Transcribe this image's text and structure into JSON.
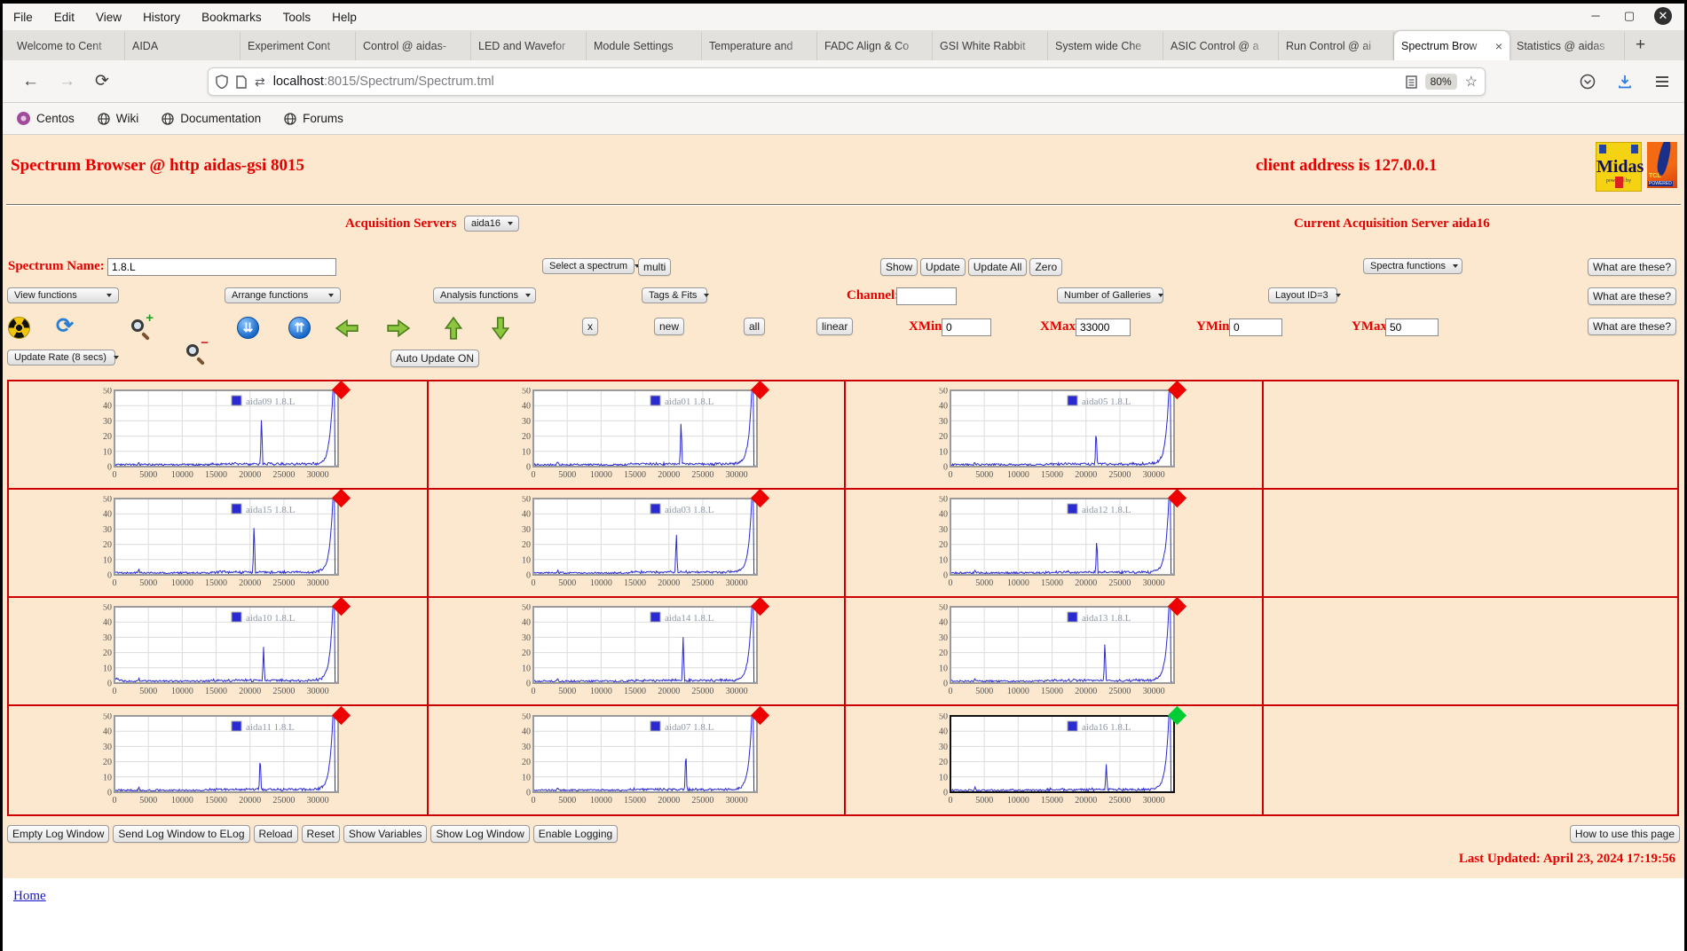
{
  "browser": {
    "menu": [
      "File",
      "Edit",
      "View",
      "History",
      "Bookmarks",
      "Tools",
      "Help"
    ],
    "window_controls": {
      "minimize": "─",
      "maximize": "▢",
      "close": "✕"
    },
    "tabs": [
      {
        "label": "Welcome to Cent",
        "active": false
      },
      {
        "label": "AIDA",
        "active": false
      },
      {
        "label": "Experiment Cont",
        "active": false
      },
      {
        "label": "Control @ aidas-",
        "active": false
      },
      {
        "label": "LED and Wavefor",
        "active": false
      },
      {
        "label": "Module Settings",
        "active": false
      },
      {
        "label": "Temperature and",
        "active": false
      },
      {
        "label": "FADC Align & Co",
        "active": false
      },
      {
        "label": "GSI White Rabbit",
        "active": false
      },
      {
        "label": "System wide Che",
        "active": false
      },
      {
        "label": "ASIC Control @ a",
        "active": false
      },
      {
        "label": "Run Control @ ai",
        "active": false
      },
      {
        "label": "Spectrum Brow",
        "active": true
      },
      {
        "label": "Statistics @ aidas",
        "active": false
      }
    ],
    "new_tab_label": "+",
    "url": {
      "host": "localhost",
      "rest": ":8015/Spectrum/Spectrum.tml"
    },
    "zoom_badge": "80%",
    "bookmarks": [
      {
        "label": "Centos",
        "icon": "centos-icon"
      },
      {
        "label": "Wiki",
        "icon": "globe-icon"
      },
      {
        "label": "Documentation",
        "icon": "globe-icon"
      },
      {
        "label": "Forums",
        "icon": "globe-icon"
      }
    ]
  },
  "page": {
    "title": "Spectrum Browser @ http aidas-gsi 8015",
    "client_address": "client address is 127.0.0.1",
    "acquisition_servers_label": "Acquisition Servers",
    "acquisition_server_selected": "aida16",
    "current_server": "Current Acquisition Server aida16",
    "spectrum_name_label": "Spectrum Name:",
    "spectrum_name_value": "1.8.L",
    "select_spectrum_label": "Select a spectrum",
    "multi_button": "multi",
    "show_button": "Show",
    "update_button": "Update",
    "update_all_button": "Update All",
    "zero_button": "Zero",
    "spectra_functions_label": "Spectra functions",
    "what_are_these_button": "What are these?",
    "view_functions_label": "View functions",
    "arrange_functions_label": "Arrange functions",
    "analysis_functions_label": "Analysis functions",
    "tags_fits_label": "Tags & Fits",
    "channel_label": "Channel:",
    "channel_value": "",
    "galleries_label": "Number of Galleries",
    "layout_label": "Layout ID=3",
    "x_button": "x",
    "new_button": "new",
    "all_button": "all",
    "linear_button": "linear",
    "xmin_label": "XMin",
    "xmin_value": "0",
    "xmax_label": "XMax",
    "xmax_value": "33000",
    "ymin_label": "YMin",
    "ymin_value": "0",
    "ymax_label": "YMax",
    "ymax_value": "50",
    "update_rate_label": "Update Rate (8 secs)",
    "auto_update_button": "Auto Update ON",
    "footer_buttons": [
      "Empty Log Window",
      "Send Log Window to ELog",
      "Reload",
      "Reset",
      "Show Variables",
      "Show Log Window",
      "Enable Logging"
    ],
    "help_button": "How to use this page",
    "last_updated": "Last Updated: April 23, 2024 17:19:56",
    "home_link": "Home",
    "colors": {
      "page_bg": "#fbe8ce",
      "accent_red": "#e60000",
      "table_border": "#cc0000",
      "plot_line": "#2a2ad0",
      "marker_red": "#ee0000",
      "marker_green": "#00cc33"
    }
  },
  "chart_data": {
    "type": "line",
    "defaults": {
      "xlim": [
        0,
        33000
      ],
      "ylim": [
        0,
        50
      ],
      "xticks": [
        0,
        5000,
        10000,
        15000,
        20000,
        25000,
        30000
      ],
      "yticks": [
        0,
        10,
        20,
        30,
        40,
        50
      ],
      "grid": true,
      "legend_position": "top-right",
      "baseline": 1,
      "edge_peak_x": 32300,
      "edge_peak_y": 50,
      "edge_drop_x": 32550
    },
    "panels": [
      {
        "legend": "aida09 1.8.L",
        "marker": "red",
        "spike_x": 21700,
        "spike_h": 34
      },
      {
        "legend": "aida01 1.8.L",
        "marker": "red",
        "spike_x": 21800,
        "spike_h": 30
      },
      {
        "legend": "aida05 1.8.L",
        "marker": "red",
        "spike_x": 21500,
        "spike_h": 26
      },
      {
        "legend": "aida15 1.8.L",
        "marker": "red",
        "spike_x": 20600,
        "spike_h": 35
      },
      {
        "legend": "aida03 1.8.L",
        "marker": "red",
        "spike_x": 21100,
        "spike_h": 28
      },
      {
        "legend": "aida12 1.8.L",
        "marker": "red",
        "spike_x": 21600,
        "spike_h": 24
      },
      {
        "legend": "aida10 1.8.L",
        "marker": "red",
        "spike_x": 22000,
        "spike_h": 22,
        "early_bump": true
      },
      {
        "legend": "aida14 1.8.L",
        "marker": "red",
        "spike_x": 22100,
        "spike_h": 30
      },
      {
        "legend": "aida13 1.8.L",
        "marker": "red",
        "spike_x": 22800,
        "spike_h": 27
      },
      {
        "legend": "aida11 1.8.L",
        "marker": "red",
        "spike_x": 21500,
        "spike_h": 24
      },
      {
        "legend": "aida07 1.8.L",
        "marker": "red",
        "spike_x": 22500,
        "spike_h": 28
      },
      {
        "legend": "aida16 1.8.L",
        "marker": "green",
        "spike_x": 23000,
        "spike_h": 18,
        "selected": true
      }
    ]
  }
}
